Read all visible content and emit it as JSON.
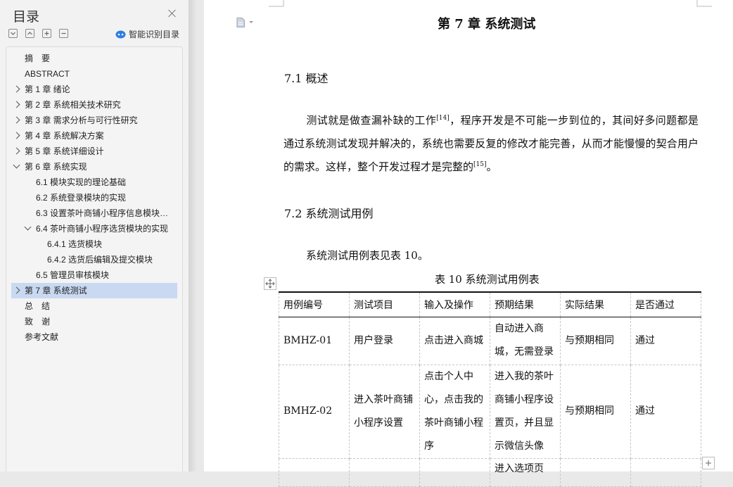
{
  "sidebar": {
    "title": "目录",
    "ai_toc_label": "智能识别目录",
    "toc": [
      {
        "label": "摘　要",
        "level": 0,
        "expander": "none"
      },
      {
        "label": "ABSTRACT",
        "level": 0,
        "expander": "none"
      },
      {
        "label": "第 1 章  绪论",
        "level": 0,
        "expander": "collapsed"
      },
      {
        "label": "第 2 章  系统相关技术研究",
        "level": 0,
        "expander": "collapsed"
      },
      {
        "label": "第 3 章  需求分析与可行性研究",
        "level": 0,
        "expander": "collapsed"
      },
      {
        "label": "第 4 章  系统解决方案",
        "level": 0,
        "expander": "collapsed"
      },
      {
        "label": "第 5 章  系统详细设计",
        "level": 0,
        "expander": "collapsed"
      },
      {
        "label": "第 6 章  系统实现",
        "level": 0,
        "expander": "expanded"
      },
      {
        "label": "6.1  模块实现的理论基础",
        "level": 1,
        "expander": "none"
      },
      {
        "label": "6.2  系统登录模块的实现",
        "level": 1,
        "expander": "none"
      },
      {
        "label": "6.3  设置茶叶商铺小程序信息模块的实现",
        "level": 1,
        "expander": "none"
      },
      {
        "label": "6.4  茶叶商铺小程序选货模块的实现",
        "level": 1,
        "expander": "expanded"
      },
      {
        "label": "6.4.1  选货模块",
        "level": 2,
        "expander": "none"
      },
      {
        "label": "6.4.2  选货后编辑及提交模块",
        "level": 2,
        "expander": "none"
      },
      {
        "label": "6.5  管理员审核模块",
        "level": 1,
        "expander": "none"
      },
      {
        "label": "第 7 章  系统测试",
        "level": 0,
        "expander": "collapsed",
        "selected": true
      },
      {
        "label": "总　结",
        "level": 0,
        "expander": "none"
      },
      {
        "label": "致　谢",
        "level": 0,
        "expander": "none"
      },
      {
        "label": "参考文献",
        "level": 0,
        "expander": "none"
      }
    ]
  },
  "document": {
    "chapter_title": "第 7 章  系统测试",
    "section1": {
      "heading": "7.1  概述",
      "para_part1": "测试就是做查漏补缺的工作",
      "ref1": "[14]",
      "para_part2": "，程序开发是不可能一步到位的，其间好多问题都是通过系统测试发现并解决的，系统也需要反复的修改才能完善，从而才能慢慢的契合用户的需求。这样，整个开发过程才是完整的",
      "ref2": "[15]",
      "para_part3": "。"
    },
    "section2": {
      "heading": "7.2  系统测试用例",
      "para": "系统测试用例表见表 10。"
    },
    "table": {
      "caption": "表 10  系统测试用例表",
      "headers": [
        "用例编号",
        "测试项目",
        "输入及操作",
        "预期结果",
        "实际结果",
        "是否通过"
      ],
      "rows": [
        [
          "BMHZ-01",
          "用户登录",
          "点击进入商城",
          "自动进入商城，无需登录",
          "与预期相同",
          "通过"
        ],
        [
          "BMHZ-02",
          "进入茶叶商铺小程序设置",
          "点击个人中心，点击我的茶叶商铺小程序",
          "进入我的茶叶商铺小程序设置页，并且显示微信头像",
          "与预期相同",
          "通过"
        ],
        [
          "",
          "",
          "",
          "进入选项页",
          "",
          ""
        ]
      ]
    }
  },
  "colors": {
    "sidebar_bg": "#f2f2f2",
    "selected_bg": "#c9d9f2",
    "page_bg": "#ffffff",
    "ai_icon": "#2f7de1"
  }
}
